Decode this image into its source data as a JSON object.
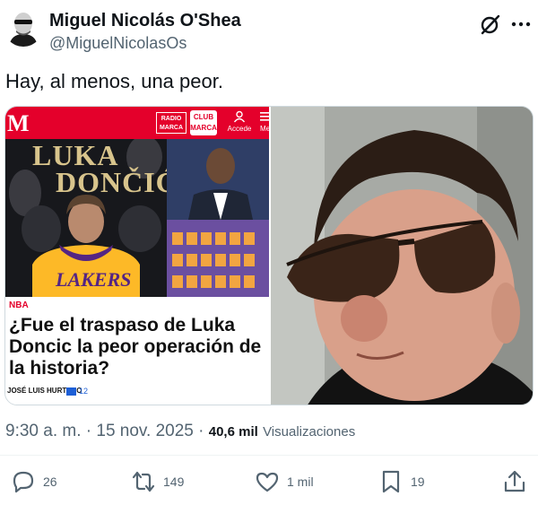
{
  "tweet": {
    "author_name": "Miguel Nicolás O'Shea",
    "author_handle": "@MiguelNicolasOs",
    "text": "Hay, al menos, una peor.",
    "time": "9:30 a. m.",
    "date": "15 nov. 2025",
    "separator": "·",
    "views_count": "40,6 mil",
    "views_label": "Visualizaciones"
  },
  "media": {
    "marca_logo": "M",
    "radio_badge_top": "RADIO",
    "radio_badge_bottom": "MARCA",
    "club_badge_top": "CLUB",
    "club_badge_bottom": "MARCA",
    "user_label": "Accede",
    "menu_label": "Me",
    "promo_title_1": "LUKA",
    "promo_title_2": "DONČIĆ",
    "jersey_text": "LAKERS",
    "section": "NBA",
    "headline": "¿Fue el traspaso de Luka Doncic la peor operación de la historia?",
    "byline": "JOSÉ LUIS HURTADO",
    "comments": "12"
  },
  "actions": {
    "replies": "26",
    "reposts": "149",
    "likes": "1 mil",
    "bookmarks": "19"
  },
  "colors": {
    "marca_red": "#e4002b",
    "text_primary": "#0f1419",
    "text_secondary": "#536471",
    "lakers_gold": "#fdb927",
    "lakers_purple": "#552583"
  },
  "icons": [
    "grok-icon",
    "more-icon",
    "reply-icon",
    "repost-icon",
    "like-icon",
    "bookmark-icon",
    "share-icon"
  ]
}
